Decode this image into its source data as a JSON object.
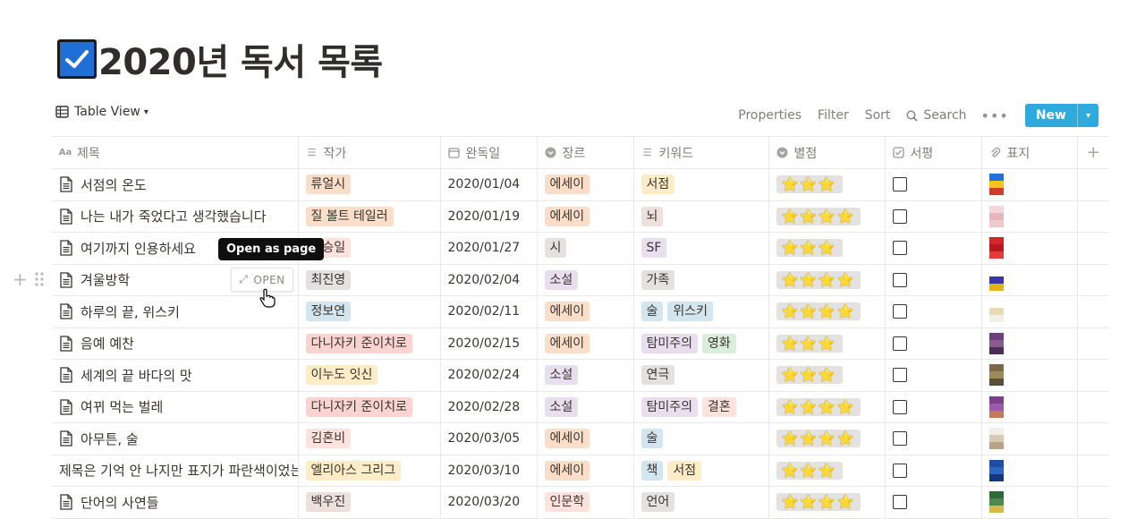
{
  "page": {
    "title": "2020년 독서 목록",
    "icon": "checkbox-emoji"
  },
  "toolbar": {
    "view_label": "Table View",
    "properties": "Properties",
    "filter": "Filter",
    "sort": "Sort",
    "search": "Search",
    "new": "New"
  },
  "columns": [
    "제목",
    "작가",
    "완독일",
    "장르",
    "키워드",
    "별점",
    "서평",
    "표지"
  ],
  "rows": [
    {
      "title": "서점의 온도",
      "author": "류얼시",
      "author_color": "c-peach",
      "date": "2020/01/04",
      "genre": "에세이",
      "genre_color": "c-peach",
      "keywords": [
        "서점"
      ],
      "keyword_colors": [
        "c-yellow"
      ],
      "rating": "⭐⭐⭐",
      "cover": [
        "#2a6fd6",
        "#f2c516",
        "#d23c2a"
      ]
    },
    {
      "title": "나는 내가 죽었다고 생각했습니다",
      "author": "질 볼트 테일러",
      "author_color": "c-peach",
      "date": "2020/01/19",
      "genre": "에세이",
      "genre_color": "c-peach",
      "keywords": [
        "뇌"
      ],
      "keyword_colors": [
        "c-brown"
      ],
      "rating": "⭐⭐⭐⭐",
      "cover": [
        "#f5d6d8",
        "#e7b7bd",
        "#f0c9cc"
      ]
    },
    {
      "title": "여기까지 인용하세요",
      "author": "김승일",
      "author_color": "c-red",
      "date": "2020/01/27",
      "genre": "시",
      "genre_color": "c-gray",
      "keywords": [
        "SF"
      ],
      "keyword_colors": [
        "c-purple"
      ],
      "rating": "⭐⭐⭐",
      "cover": [
        "#d8232a",
        "#b81620",
        "#e33b3b"
      ]
    },
    {
      "title": "겨울방학",
      "author": "최진영",
      "author_color": "c-gray",
      "date": "2020/02/04",
      "genre": "소설",
      "genre_color": "c-purple",
      "keywords": [
        "가족"
      ],
      "keyword_colors": [
        "c-gray"
      ],
      "rating": "⭐⭐⭐⭐",
      "cover": [
        "#ffffff",
        "#3b36a8",
        "#e0b51c"
      ]
    },
    {
      "title": "하루의 끝, 위스키",
      "author": "정보연",
      "author_color": "c-blue",
      "date": "2020/02/11",
      "genre": "에세이",
      "genre_color": "c-peach",
      "keywords": [
        "술",
        "위스키"
      ],
      "keyword_colors": [
        "c-blue",
        "c-blue"
      ],
      "rating": "⭐⭐⭐⭐",
      "cover": [
        "#ffffff",
        "#e8d9b8",
        "#f4f0e6"
      ]
    },
    {
      "title": "음예 예찬",
      "author": "다니자키 준이치로",
      "author_color": "c-red2",
      "date": "2020/02/15",
      "genre": "에세이",
      "genre_color": "c-peach",
      "keywords": [
        "탐미주의",
        "영화"
      ],
      "keyword_colors": [
        "c-purple",
        "c-green"
      ],
      "rating": "⭐⭐⭐",
      "cover": [
        "#6b3f7a",
        "#8a5b8f",
        "#4c2d58"
      ]
    },
    {
      "title": "세계의 끝 바다의 맛",
      "author": "이누도 잇신",
      "author_color": "c-yellow",
      "date": "2020/02/24",
      "genre": "소설",
      "genre_color": "c-purple",
      "keywords": [
        "연극"
      ],
      "keyword_colors": [
        "c-gray"
      ],
      "rating": "⭐⭐⭐",
      "cover": [
        "#7a6a4a",
        "#9c8a5c",
        "#5b4f37"
      ]
    },
    {
      "title": "여뀌 먹는 벌레",
      "author": "다니자키 준이치로",
      "author_color": "c-red2",
      "date": "2020/02/28",
      "genre": "소설",
      "genre_color": "c-purple",
      "keywords": [
        "탐미주의",
        "결혼"
      ],
      "keyword_colors": [
        "c-purple",
        "c-red"
      ],
      "rating": "⭐⭐⭐⭐",
      "cover": [
        "#7d3f8c",
        "#9a5aa6",
        "#c27b5a"
      ]
    },
    {
      "title": "아무튼, 술",
      "author": "김혼비",
      "author_color": "c-red",
      "date": "2020/03/05",
      "genre": "에세이",
      "genre_color": "c-peach",
      "keywords": [
        "술"
      ],
      "keyword_colors": [
        "c-blue"
      ],
      "rating": "⭐⭐⭐⭐",
      "cover": [
        "#f1efe8",
        "#d7c9b2",
        "#b7a488"
      ]
    },
    {
      "title": "제목은 기억 안 나지만 표지가 파란색이었는데요",
      "author": "엘리아스 그리그",
      "author_color": "c-yellow",
      "date": "2020/03/10",
      "genre": "에세이",
      "genre_color": "c-peach",
      "keywords": [
        "책",
        "서점"
      ],
      "keyword_colors": [
        "c-blue",
        "c-yellow"
      ],
      "rating": "⭐⭐⭐",
      "cover": [
        "#1e4fa0",
        "#2d66c0",
        "#15377a"
      ]
    },
    {
      "title": "단어의 사연들",
      "author": "백우진",
      "author_color": "c-brown",
      "date": "2020/03/20",
      "genre": "인문학",
      "genre_color": "c-red",
      "keywords": [
        "언어"
      ],
      "keyword_colors": [
        "c-gray"
      ],
      "rating": "⭐⭐⭐⭐",
      "cover": [
        "#2f6a3a",
        "#4f8a4c",
        "#d7b94a"
      ]
    }
  ],
  "hover": {
    "tooltip": "Open as page",
    "open_button": "OPEN"
  }
}
